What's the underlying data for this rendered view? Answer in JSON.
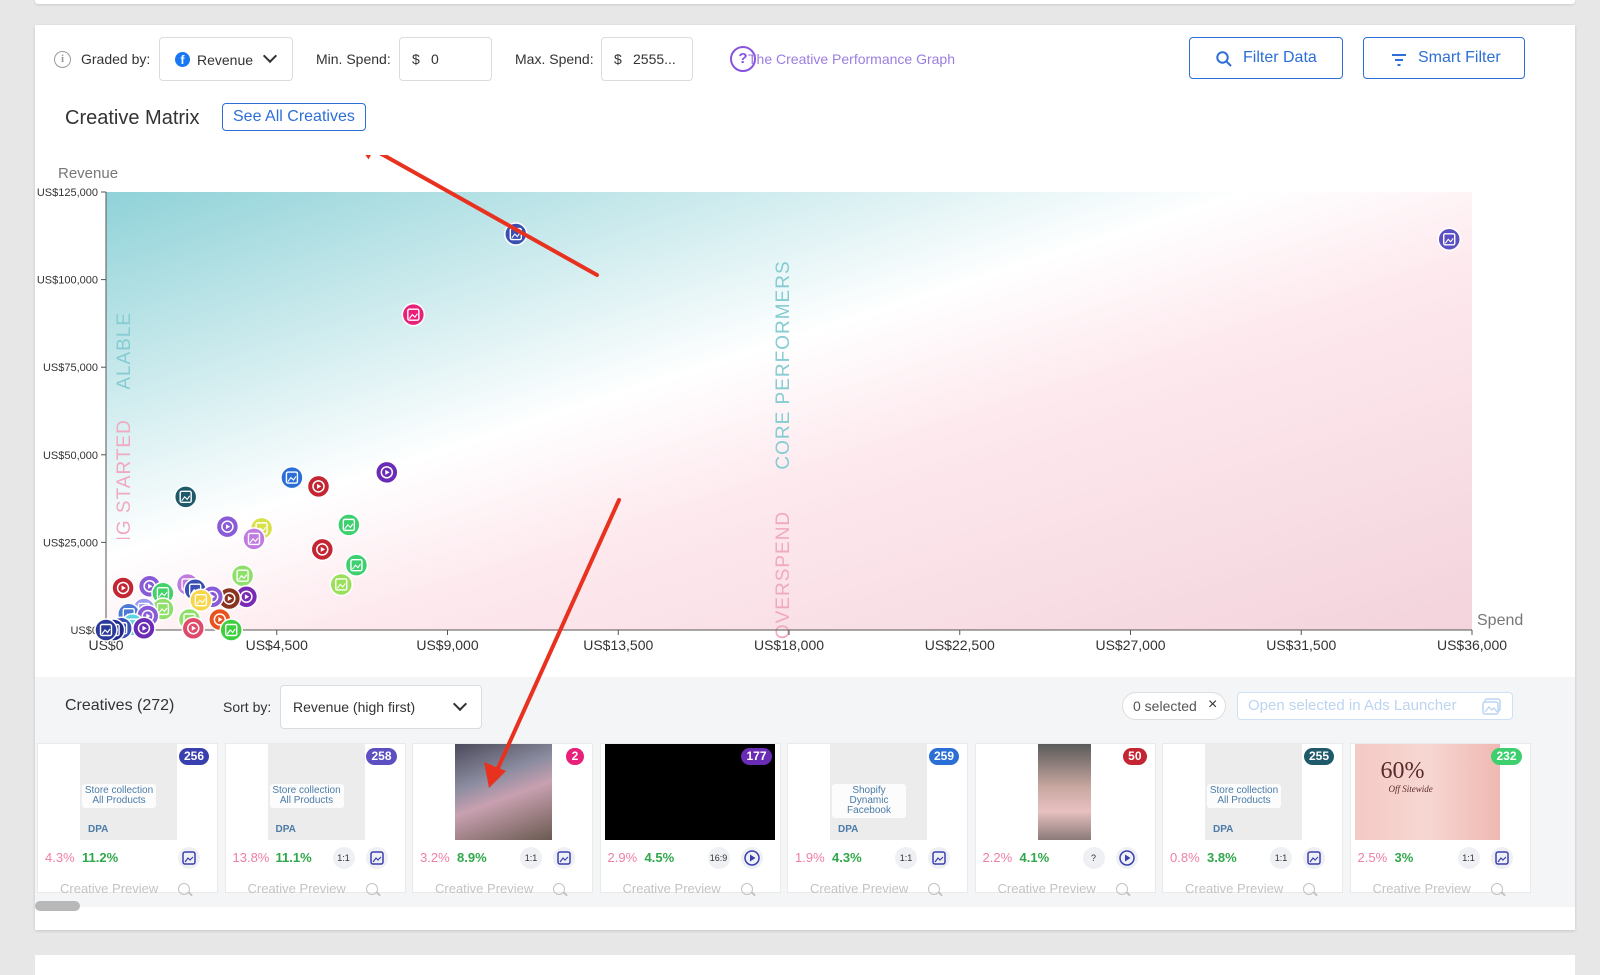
{
  "toolbar": {
    "graded_by_label": "Graded by:",
    "graded_by_value": "Revenue",
    "min_spend_label": "Min. Spend:",
    "min_spend_currency": "$",
    "min_spend_value": "0",
    "max_spend_label": "Max. Spend:",
    "max_spend_currency": "$",
    "max_spend_value": "2555...",
    "help_link": "The Creative Performance Graph",
    "filter_data": "Filter Data",
    "smart_filter": "Smart Filter"
  },
  "matrix": {
    "title": "Creative Matrix",
    "see_all": "See All Creatives"
  },
  "chart_data": {
    "type": "scatter",
    "ylabel": "Revenue",
    "xlabel": "Spend",
    "x_ticks": [
      "US$0",
      "US$4,500",
      "US$9,000",
      "US$13,500",
      "US$18,000",
      "US$22,500",
      "US$27,000",
      "US$31,500",
      "US$36,000"
    ],
    "y_ticks": [
      "US$0",
      "US$25,000",
      "US$50,000",
      "US$75,000",
      "US$100,000",
      "US$125,000"
    ],
    "xlim": [
      0,
      36000
    ],
    "ylim": [
      0,
      125000
    ],
    "quadrant_labels": [
      "SCALABLE",
      "GETTING STARTED",
      "CORE PERFORMERS",
      "OVERSPEND"
    ],
    "colors": {
      "teal": "#86ccd3",
      "pink": "#f0a9c1",
      "axis": "#555555",
      "arrow": "#e8321f"
    },
    "points": [
      {
        "x": 10800,
        "y": 113000,
        "color": "#3a4fb2",
        "icon": "image"
      },
      {
        "x": 35400,
        "y": 111500,
        "color": "#5b4fc2",
        "icon": "image"
      },
      {
        "x": 8100,
        "y": 90000,
        "color": "#e8207a",
        "icon": "image"
      },
      {
        "x": 7400,
        "y": 45000,
        "color": "#6a2bb5",
        "icon": "video"
      },
      {
        "x": 4900,
        "y": 43500,
        "color": "#2b6fd6",
        "icon": "image"
      },
      {
        "x": 5600,
        "y": 41000,
        "color": "#c42532",
        "icon": "video"
      },
      {
        "x": 2100,
        "y": 38000,
        "color": "#1f5a6a",
        "icon": "image"
      },
      {
        "x": 6400,
        "y": 30000,
        "color": "#3ecf6e",
        "icon": "image"
      },
      {
        "x": 3200,
        "y": 29500,
        "color": "#8a5bd6",
        "icon": "video"
      },
      {
        "x": 4100,
        "y": 29000,
        "color": "#d8e04a",
        "icon": "image"
      },
      {
        "x": 3900,
        "y": 26000,
        "color": "#c07be0",
        "icon": "image"
      },
      {
        "x": 5700,
        "y": 23000,
        "color": "#c42532",
        "icon": "video"
      },
      {
        "x": 6600,
        "y": 18500,
        "color": "#3ecf6e",
        "icon": "image"
      },
      {
        "x": 3600,
        "y": 15500,
        "color": "#8fe06a",
        "icon": "image"
      },
      {
        "x": 6200,
        "y": 13000,
        "color": "#9ae05a",
        "icon": "image"
      },
      {
        "x": 450,
        "y": 12000,
        "color": "#c42532",
        "icon": "video"
      },
      {
        "x": 1150,
        "y": 12500,
        "color": "#8a5bd6",
        "icon": "video"
      },
      {
        "x": 2150,
        "y": 13000,
        "color": "#c07be0",
        "icon": "image"
      },
      {
        "x": 2350,
        "y": 11500,
        "color": "#3a4fb2",
        "icon": "image"
      },
      {
        "x": 1500,
        "y": 10500,
        "color": "#43d16a",
        "icon": "image"
      },
      {
        "x": 3700,
        "y": 9500,
        "color": "#7a2bb5",
        "icon": "video"
      },
      {
        "x": 3250,
        "y": 9000,
        "color": "#8a3320",
        "icon": "video"
      },
      {
        "x": 2800,
        "y": 9500,
        "color": "#8a5bd6",
        "icon": "video"
      },
      {
        "x": 2500,
        "y": 8500,
        "color": "#f7d64a",
        "icon": "image"
      },
      {
        "x": 1500,
        "y": 6000,
        "color": "#8fe06a",
        "icon": "image"
      },
      {
        "x": 1000,
        "y": 6000,
        "color": "#9a9af0",
        "icon": "image"
      },
      {
        "x": 3000,
        "y": 3000,
        "color": "#e8521f",
        "icon": "video"
      },
      {
        "x": 2200,
        "y": 3000,
        "color": "#8fe06a",
        "icon": "image"
      },
      {
        "x": 2300,
        "y": 500,
        "color": "#e04a6a",
        "icon": "video"
      },
      {
        "x": 3300,
        "y": 0,
        "color": "#3ecf3e",
        "icon": "image"
      },
      {
        "x": 600,
        "y": 4500,
        "color": "#4e7ad6",
        "icon": "image"
      },
      {
        "x": 1100,
        "y": 4000,
        "color": "#8a5bd6",
        "icon": "video"
      },
      {
        "x": 700,
        "y": 1500,
        "color": "#5ad6e0",
        "icon": "image"
      },
      {
        "x": 400,
        "y": 500,
        "color": "#3a4fb2",
        "icon": "image"
      },
      {
        "x": 1000,
        "y": 500,
        "color": "#6a2bb5",
        "icon": "video"
      },
      {
        "x": 200,
        "y": 0,
        "color": "#1f2a8a",
        "icon": "image"
      },
      {
        "x": 0,
        "y": 0,
        "color": "#2b3a9a",
        "icon": "image"
      }
    ]
  },
  "creatives": {
    "title": "Creatives (272)",
    "sort_label": "Sort by:",
    "sort_value": "Revenue (high first)",
    "selected": "0 selected",
    "open_selected": "Open selected in Ads Launcher",
    "preview_label": "Creative Preview",
    "cards": [
      {
        "badge": "256",
        "badge_color": "#3a3fb0",
        "m1": "4.3%",
        "m2": "11.2%",
        "thumb": "store",
        "thumb_text": "Store collection All Products",
        "tag": "DPA",
        "ratio": "",
        "icon": "image"
      },
      {
        "badge": "258",
        "badge_color": "#5b4fc2",
        "m1": "13.8%",
        "m2": "11.1%",
        "thumb": "store",
        "thumb_text": "Store collection All Products",
        "tag": "DPA",
        "ratio": "1:1",
        "icon": "image"
      },
      {
        "badge": "2",
        "badge_color": "#e8207a",
        "m1": "3.2%",
        "m2": "8.9%",
        "thumb": "photo",
        "thumb_text": "",
        "tag": "",
        "ratio": "1:1",
        "icon": "image"
      },
      {
        "badge": "177",
        "badge_color": "#6a2bb5",
        "m1": "2.9%",
        "m2": "4.5%",
        "thumb": "dark",
        "thumb_text": "",
        "tag": "",
        "ratio": "16:9",
        "icon": "video"
      },
      {
        "badge": "259",
        "badge_color": "#2b6fd6",
        "m1": "1.9%",
        "m2": "4.3%",
        "thumb": "store",
        "thumb_text": "Shopify Dynamic Facebook",
        "tag": "DPA",
        "ratio": "1:1",
        "icon": "image"
      },
      {
        "badge": "50",
        "badge_color": "#c42532",
        "m1": "2.2%",
        "m2": "4.1%",
        "thumb": "hand",
        "thumb_text": "",
        "tag": "",
        "ratio": "?",
        "icon": "video"
      },
      {
        "badge": "255",
        "badge_color": "#1f5a6a",
        "m1": "0.8%",
        "m2": "3.8%",
        "thumb": "store",
        "thumb_text": "Store collection All Products",
        "tag": "DPA",
        "ratio": "1:1",
        "icon": "image"
      },
      {
        "badge": "232",
        "badge_color": "#3ecf6e",
        "m1": "2.5%",
        "m2": "3%",
        "thumb": "promo",
        "thumb_text": "60%",
        "tag": "Off Sitewide",
        "ratio": "1:1",
        "icon": "image"
      }
    ]
  }
}
